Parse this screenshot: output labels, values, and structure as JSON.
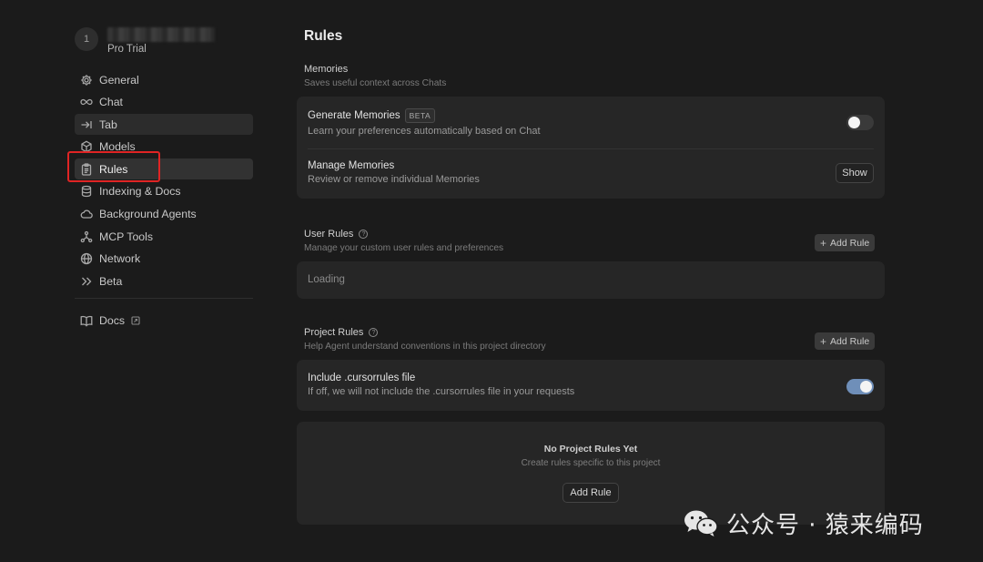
{
  "user": {
    "avatar_initial": "1",
    "plan": "Pro Trial"
  },
  "sidebar": {
    "items": [
      {
        "label": "General",
        "icon": "gear-icon"
      },
      {
        "label": "Chat",
        "icon": "infinity-icon"
      },
      {
        "label": "Tab",
        "icon": "arrow-right-bar-icon"
      },
      {
        "label": "Models",
        "icon": "cube-icon"
      },
      {
        "label": "Rules",
        "icon": "clipboard-icon"
      },
      {
        "label": "Indexing & Docs",
        "icon": "database-icon"
      },
      {
        "label": "Background Agents",
        "icon": "cloud-icon"
      },
      {
        "label": "MCP Tools",
        "icon": "nodes-icon"
      },
      {
        "label": "Network",
        "icon": "globe-icon"
      },
      {
        "label": "Beta",
        "icon": "double-chevron-right-icon"
      }
    ],
    "docs_label": "Docs"
  },
  "page": {
    "title": "Rules"
  },
  "memories": {
    "title": "Memories",
    "subtitle": "Saves useful context across Chats",
    "generate_title": "Generate Memories",
    "generate_badge": "BETA",
    "generate_sub": "Learn your preferences automatically based on Chat",
    "generate_enabled": false,
    "manage_title": "Manage Memories",
    "manage_sub": "Review or remove individual Memories",
    "show_label": "Show"
  },
  "user_rules": {
    "title": "User Rules",
    "subtitle": "Manage your custom user rules and preferences",
    "add_label": "Add Rule",
    "loading_text": "Loading"
  },
  "project_rules": {
    "title": "Project Rules",
    "subtitle": "Help Agent understand conventions in this project directory",
    "add_label": "Add Rule",
    "cursorrules_title": "Include .cursorrules file",
    "cursorrules_sub": "If off, we will not include the .cursorrules file in your requests",
    "cursorrules_enabled": true,
    "empty_title": "No Project Rules Yet",
    "empty_sub": "Create rules specific to this project",
    "empty_add_label": "Add Rule"
  },
  "watermark": {
    "text": "公众号 · 猿来编码"
  },
  "colors": {
    "background": "#1b1b1b",
    "card": "#262626",
    "toggle_on": "#6f8fb9",
    "highlight": "#e02424"
  }
}
